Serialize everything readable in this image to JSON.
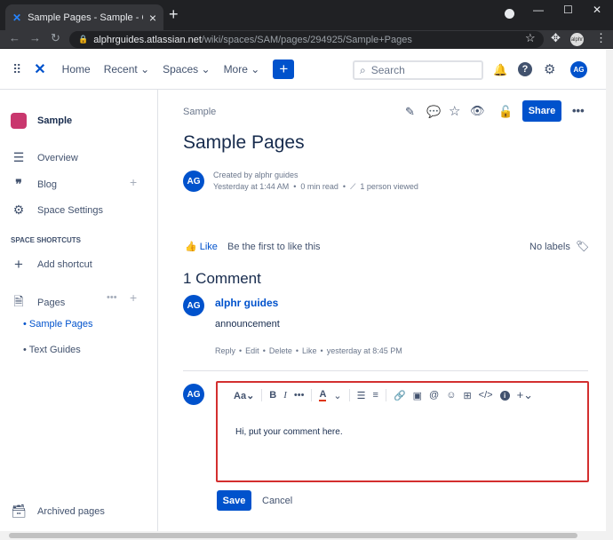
{
  "browser": {
    "tab_title": "Sample Pages - Sample - Conflu",
    "url_domain": "alphrguides.atlassian.net",
    "url_path": "/wiki/spaces/SAM/pages/294925/Sample+Pages",
    "profile_label": "alphr"
  },
  "topnav": {
    "home": "Home",
    "recent": "Recent",
    "spaces": "Spaces",
    "more": "More",
    "create_label": "+",
    "search_placeholder": "Search",
    "user_initials": "AG"
  },
  "sidebar": {
    "space_name": "Sample",
    "overview": "Overview",
    "blog": "Blog",
    "space_settings": "Space Settings",
    "shortcuts_heading": "SPACE SHORTCUTS",
    "add_shortcut": "Add shortcut",
    "pages": "Pages",
    "page_items": [
      "Sample Pages",
      "Text Guides"
    ],
    "archived": "Archived pages"
  },
  "page": {
    "breadcrumb": "Sample",
    "share": "Share",
    "title": "Sample Pages",
    "author_initials": "AG",
    "created_by": "Created by alphr guides",
    "meta_time": "Yesterday at 1:44 AM",
    "meta_read": "0 min read",
    "meta_viewed": "1 person viewed",
    "like": "Like",
    "like_prompt": "Be the first to like this",
    "no_labels": "No labels"
  },
  "comments": {
    "heading": "1 Comment",
    "items": [
      {
        "initials": "AG",
        "author": "alphr guides",
        "body": "announcement",
        "reply": "Reply",
        "edit": "Edit",
        "delete": "Delete",
        "like": "Like",
        "time": "yesterday at 8:45 PM"
      }
    ],
    "editor_initials": "AG",
    "editor_text": "Hi, put your comment here.",
    "editor_font_label": "Aa",
    "save": "Save",
    "cancel": "Cancel"
  }
}
